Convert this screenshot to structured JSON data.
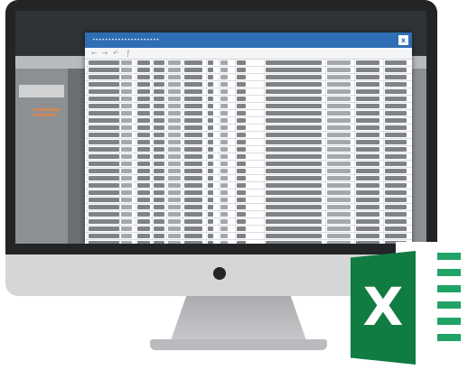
{
  "dialog": {
    "title": "•••••••••••••••••••••",
    "close_label": "x"
  },
  "toolbar_icons": [
    "back-icon",
    "forward-icon",
    "undo-icon",
    "fx-icon"
  ],
  "excel": {
    "letter": "X",
    "brand_color": "#107c41",
    "accent_color": "#21a366"
  },
  "colors": {
    "dialog_title_bar": "#2e6eb5",
    "monitor_bezel": "#222426",
    "monitor_frame": "#d4d6d8"
  }
}
